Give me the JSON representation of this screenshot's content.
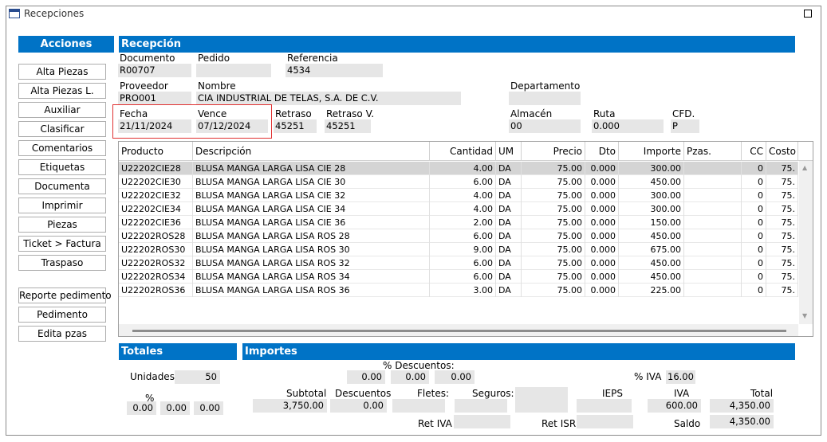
{
  "window": {
    "title": "Recepciones"
  },
  "actions": {
    "header": "Acciones",
    "buttons": [
      "Alta Piezas",
      "Alta Piezas L.",
      "Auxiliar",
      "Clasificar",
      "Comentarios",
      "Etiquetas",
      "Documenta",
      "Imprimir",
      "Piezas",
      "Ticket > Factura",
      "Traspaso"
    ],
    "buttons2": [
      "Reporte pedimento",
      "Pedimento",
      "Edita pzas"
    ]
  },
  "recepcion": {
    "header": "Recepción",
    "documento_label": "Documento",
    "documento": "R00707",
    "pedido_label": "Pedido",
    "pedido": "",
    "referencia_label": "Referencia",
    "referencia": "4534",
    "proveedor_label": "Proveedor",
    "proveedor": "PRO001",
    "nombre_label": "Nombre",
    "nombre": "CIA INDUSTRIAL DE TELAS, S.A. DE C.V.",
    "departamento_label": "Departamento",
    "departamento": "",
    "fecha_label": "Fecha",
    "fecha": "21/11/2024",
    "vence_label": "Vence",
    "vence": "07/12/2024",
    "retraso_label": "Retraso",
    "retraso": "45251",
    "retrasov_label": "Retraso V.",
    "retrasov": "45251",
    "almacen_label": "Almacén",
    "almacen": "00",
    "ruta_label": "Ruta",
    "ruta": "0.000",
    "cfd_label": "CFD.",
    "cfd": "P"
  },
  "grid": {
    "columns": [
      "Producto",
      "Descripción",
      "Cantidad",
      "UM",
      "Precio",
      "Dto",
      "Importe",
      "Pzas.",
      "CC",
      "Costo"
    ],
    "rows": [
      [
        "U22202CIE28",
        "BLUSA MANGA LARGA LISA CIE 28",
        "4.00",
        "DA",
        "75.00",
        "0.000",
        "300.00",
        "",
        "0",
        "75."
      ],
      [
        "U22202CIE30",
        "BLUSA MANGA LARGA LISA CIE 30",
        "6.00",
        "DA",
        "75.00",
        "0.000",
        "450.00",
        "",
        "0",
        "75."
      ],
      [
        "U22202CIE32",
        "BLUSA MANGA LARGA LISA CIE 32",
        "4.00",
        "DA",
        "75.00",
        "0.000",
        "300.00",
        "",
        "0",
        "75."
      ],
      [
        "U22202CIE34",
        "BLUSA MANGA LARGA LISA CIE 34",
        "4.00",
        "DA",
        "75.00",
        "0.000",
        "300.00",
        "",
        "0",
        "75."
      ],
      [
        "U22202CIE36",
        "BLUSA MANGA LARGA LISA CIE 36",
        "2.00",
        "DA",
        "75.00",
        "0.000",
        "150.00",
        "",
        "0",
        "75."
      ],
      [
        "U22202ROS28",
        "BLUSA MANGA LARGA LISA ROS 28",
        "6.00",
        "DA",
        "75.00",
        "0.000",
        "450.00",
        "",
        "0",
        "75."
      ],
      [
        "U22202ROS30",
        "BLUSA MANGA LARGA LISA ROS 30",
        "9.00",
        "DA",
        "75.00",
        "0.000",
        "675.00",
        "",
        "0",
        "75."
      ],
      [
        "U22202ROS32",
        "BLUSA MANGA LARGA LISA ROS 32",
        "6.00",
        "DA",
        "75.00",
        "0.000",
        "450.00",
        "",
        "0",
        "75."
      ],
      [
        "U22202ROS34",
        "BLUSA MANGA LARGA LISA ROS 34",
        "6.00",
        "DA",
        "75.00",
        "0.000",
        "450.00",
        "",
        "0",
        "75."
      ],
      [
        "U22202ROS36",
        "BLUSA MANGA LARGA LISA ROS 36",
        "3.00",
        "DA",
        "75.00",
        "0.000",
        "225.00",
        "",
        "0",
        "75."
      ]
    ]
  },
  "totales": {
    "header": "Totales",
    "unidades_label": "Unidades",
    "unidades": "50",
    "pct_label": "%",
    "pct1": "0.00",
    "pct2": "0.00",
    "pct3": "0.00"
  },
  "importes": {
    "header": "Importes",
    "descuentos_pct_label": "% Descuentos:",
    "desc1": "0.00",
    "desc2": "0.00",
    "desc3": "0.00",
    "iva_pct_label": "% IVA",
    "iva_pct": "16.00",
    "subtotal_label": "Subtotal",
    "subtotal": "3,750.00",
    "descuentos_label": "Descuentos",
    "descuentos": "0.00",
    "fletes_label": "Fletes:",
    "fletes": "",
    "seguros_label": "Seguros:",
    "seguros": "",
    "ieps_label": "IEPS",
    "ieps": "",
    "iva_label": "IVA",
    "iva": "600.00",
    "total_label": "Total",
    "total": "4,350.00",
    "retiva_label": "Ret IVA",
    "retiva": "",
    "retisr_label": "Ret ISR",
    "retisr": "",
    "saldo_label": "Saldo",
    "saldo": "4,350.00"
  }
}
